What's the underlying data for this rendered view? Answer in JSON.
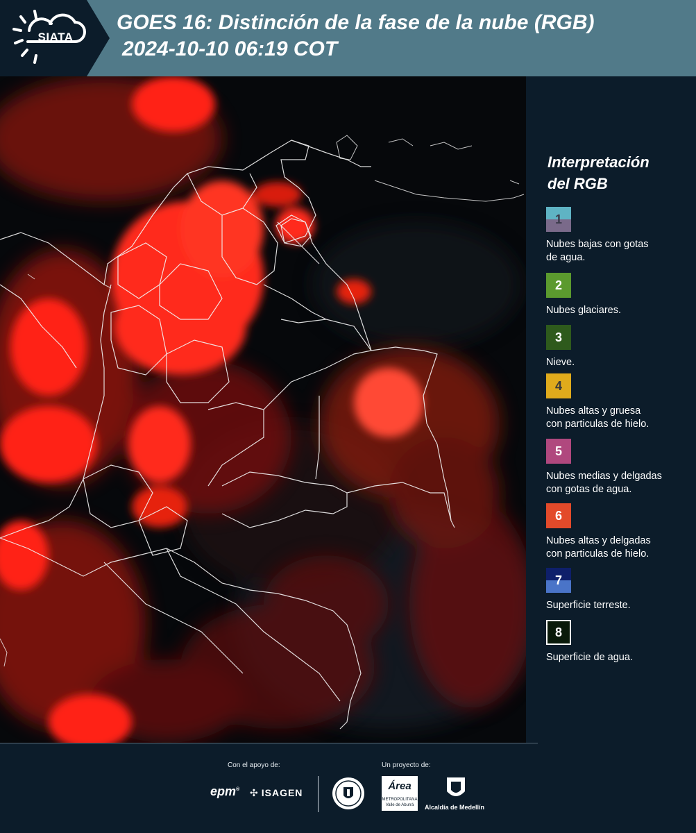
{
  "header": {
    "logo_text": "SIATA",
    "title_line1": "GOES 16: Distinción de la fase de la nube (RGB)",
    "title_line2": "2024-10-10 06:19 COT"
  },
  "legend": {
    "title_line1": "Interpretación",
    "title_line2": "del RGB",
    "items": [
      {
        "num": "1",
        "label_lines": [
          "Nubes bajas con gotas",
          "de agua."
        ],
        "color_top": "#5fb3c4",
        "color_bottom": "#7a6a8a",
        "num_color": "#3a3a4a"
      },
      {
        "num": "2",
        "label_lines": [
          "Nubes glaciares."
        ],
        "color_top": "#5b9a2e",
        "color_bottom": "#5b9a2e",
        "num_color": "#ffffff"
      },
      {
        "num": "3",
        "label_lines": [
          "Nieve."
        ],
        "color_top": "#2e5a1c",
        "color_bottom": "#2e5a1c",
        "num_color": "#ffffff"
      },
      {
        "num": "4",
        "label_lines": [
          "Nubes altas y gruesa",
          "con particulas de hielo."
        ],
        "color_top": "#e0ab1c",
        "color_bottom": "#e0ab1c",
        "num_color": "#3a3a3a"
      },
      {
        "num": "5",
        "label_lines": [
          "Nubes medias y delgadas",
          "con gotas de agua."
        ],
        "color_top": "#b0487e",
        "color_bottom": "#b0487e",
        "num_color": "#ffffff"
      },
      {
        "num": "6",
        "label_lines": [
          "Nubes altas y delgadas",
          "con particulas de hielo."
        ],
        "color_top": "#e34a2a",
        "color_bottom": "#e34a2a",
        "num_color": "#ffffff"
      },
      {
        "num": "7",
        "label_lines": [
          "Superficie terreste."
        ],
        "color_top": "#0e1f6a",
        "color_bottom": "#4a74c8",
        "num_color": "#ffffff"
      },
      {
        "num": "8",
        "label_lines": [
          "Superficie de agua."
        ],
        "color_top": "#0a1a0a",
        "color_bottom": "#0a1a0a",
        "num_color": "#ffffff",
        "border": "#ffffff"
      }
    ]
  },
  "footer": {
    "support_label": "Con el apoyo de:",
    "project_label": "Un proyecto de:",
    "epm": "epm",
    "isagen": "ISAGEN",
    "area_title": "Área",
    "area_sub1": "METROPOLITANA",
    "area_sub2": "Valle de Aburrá",
    "alcaldia": "Alcaldía de Medellín"
  },
  "colors": {
    "header_bg": "#517a89",
    "panel_bg": "#0c1c2a",
    "cloud_red": "#ff2a1a"
  }
}
